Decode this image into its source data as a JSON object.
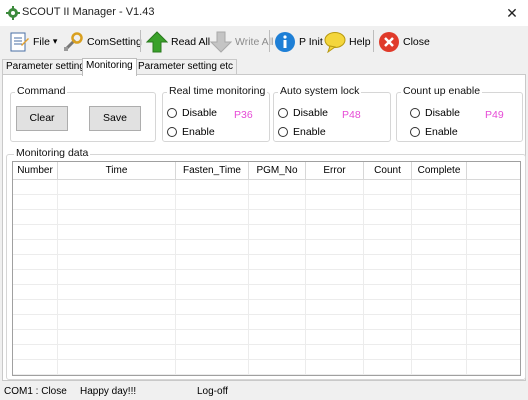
{
  "window": {
    "title": "SCOUT II  Manager - V1.43",
    "close_glyph": "✕"
  },
  "toolbar": {
    "file_label": "File",
    "file_arrow": "▾",
    "comsetting_label": "ComSetting",
    "readall_label": "Read All",
    "writeall_label": "Write All",
    "pinit_label": "P Init",
    "help_label": "Help",
    "close_label": "Close"
  },
  "tabs": [
    {
      "label": "Parameter setting",
      "active": false
    },
    {
      "label": "Monitoring",
      "active": true
    },
    {
      "label": "Parameter setting etc",
      "active": false
    }
  ],
  "command": {
    "title": "Command",
    "clear_label": "Clear",
    "save_label": "Save"
  },
  "realtime": {
    "title": "Real time monitoring",
    "disable_label": "Disable",
    "enable_label": "Enable",
    "code": "P36"
  },
  "autolock": {
    "title": "Auto system lock",
    "disable_label": "Disable",
    "enable_label": "Enable",
    "code": "P48"
  },
  "countup": {
    "title": "Count up enable",
    "disable_label": "Disable",
    "enable_label": "Enable",
    "code": "P49"
  },
  "monitoring": {
    "title": "Monitoring data",
    "columns": [
      "Number",
      "Time",
      "Fasten_Time",
      "PGM_No",
      "Error",
      "Count",
      "Complete"
    ]
  },
  "status": {
    "port": "COM1 : Close",
    "message": "Happy day!!!",
    "login": "Log-off"
  },
  "colors": {
    "param_code": "#e64ad6",
    "readall_icon": "#3aa12a",
    "pinit_icon": "#1e7fd6",
    "close_icon": "#e03a2a",
    "help_icon": "#f4d63c"
  }
}
